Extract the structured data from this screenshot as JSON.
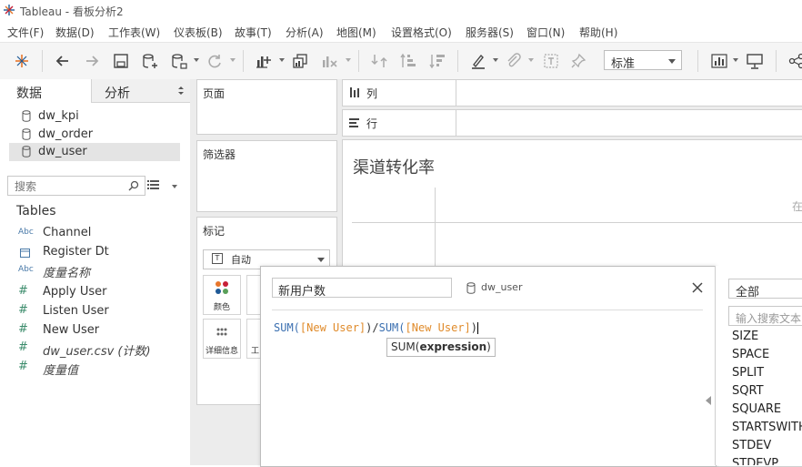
{
  "window": {
    "title": "Tableau - 看板分析2"
  },
  "menu": [
    "文件(F)",
    "数据(D)",
    "工作表(W)",
    "仪表板(B)",
    "故事(T)",
    "分析(A)",
    "地图(M)",
    "设置格式(O)",
    "服务器(S)",
    "窗口(N)",
    "帮助(H)"
  ],
  "toolbar": {
    "fit_select": "标准"
  },
  "left_panel": {
    "tabs": {
      "data": "数据",
      "analysis": "分析"
    },
    "datasources": [
      "dw_kpi",
      "dw_order",
      "dw_user"
    ],
    "search_placeholder": "搜索",
    "tables_heading": "Tables",
    "dimensions": [
      {
        "type": "Abc",
        "name": "Channel",
        "italic": false
      },
      {
        "type": "date",
        "name": "Register Dt",
        "italic": false
      },
      {
        "type": "Abc",
        "name": "度量名称",
        "italic": true
      }
    ],
    "measures": [
      {
        "name": "Apply User",
        "italic": false
      },
      {
        "name": "Listen User",
        "italic": false
      },
      {
        "name": "New User",
        "italic": false
      },
      {
        "name": "dw_user.csv (计数)",
        "italic": true
      },
      {
        "name": "度量值",
        "italic": true
      }
    ]
  },
  "shelves": {
    "pages": "页面",
    "filters": "筛选器",
    "marks": "标记",
    "mark_type": "自动",
    "mark_color": "颜色",
    "mark_detail": "详细信息",
    "mark_tooltip": "工",
    "columns": "列",
    "rows": "行"
  },
  "view": {
    "title": "渠道转化率",
    "right_hint": "在"
  },
  "calc_dialog": {
    "name": "新用户数",
    "datasource": "dw_user",
    "formula": {
      "fn1": "SUM(",
      "field1": "[New User]",
      "mid": ")/",
      "fn2": "SUM(",
      "field2": "[New User]",
      "end": ")"
    },
    "tooltip_fn": "SUM(",
    "tooltip_arg": "expression",
    "tooltip_end": ")"
  },
  "function_panel": {
    "category": "全部",
    "search_placeholder": "输入搜索文本",
    "items": [
      "SIZE",
      "SPACE",
      "SPLIT",
      "SQRT",
      "SQUARE",
      "STARTSWITH",
      "STDEV",
      "STDEVP"
    ]
  },
  "colors": {
    "accent_blue": "#3a6fb0",
    "field_orange": "#e08b2b",
    "panel_gray": "#ececec"
  }
}
